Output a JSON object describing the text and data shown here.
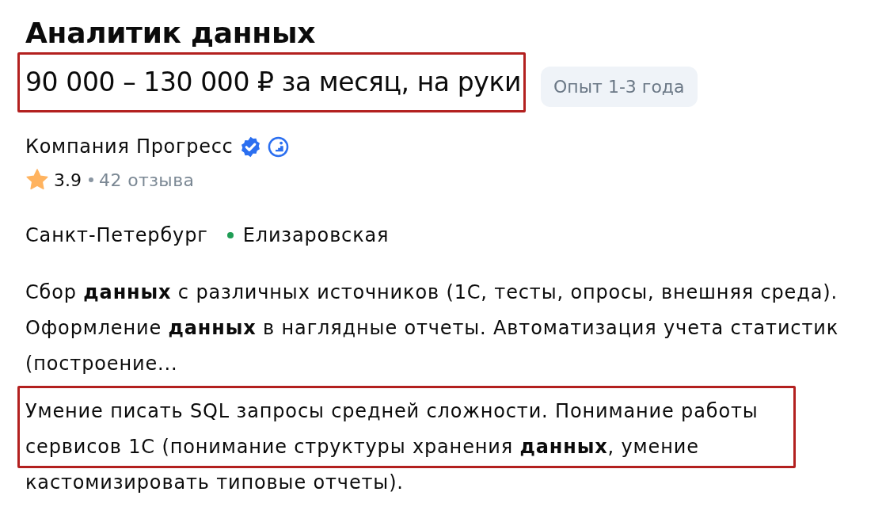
{
  "vacancy": {
    "title": "Аналитик данных",
    "salary": {
      "text": "90 000 – 130 000 ₽ за месяц, на руки",
      "highlighted": true
    },
    "experience": "Опыт 1-3 года"
  },
  "company": {
    "name": "Компания Прогресс",
    "verified": true,
    "rating": "3.9",
    "reviews": "42 отзыва"
  },
  "location": {
    "city": "Санкт-Петербург",
    "metro": {
      "name": "Елизаровская",
      "color": "#1f9d55"
    }
  },
  "description": "Сбор **данных** с различных источников (1С, тесты, опросы, внешняя среда). Оформление **данных** в наглядные отчеты. Автоматизация учета статистик (построение...",
  "requirements": {
    "text": "Умение писать SQL запросы средней сложности. Понимание работы сервисов 1С (понимание структуры хранения **данных**, умение кастомизировать типовые отчеты).",
    "highlighted": true
  }
}
